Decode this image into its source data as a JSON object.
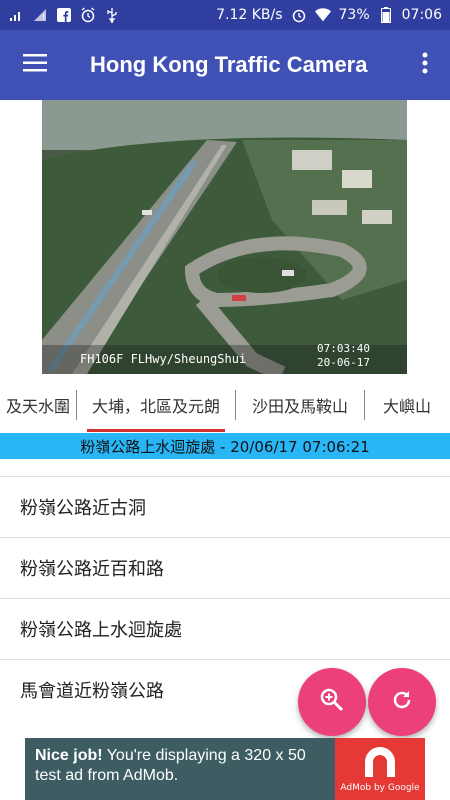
{
  "status_bar": {
    "net_speed": "7.12 KB/s",
    "battery": "73%",
    "time": "07:06"
  },
  "app_bar": {
    "title": "Hong Kong Traffic Camera"
  },
  "camera": {
    "overlay_code": "FH106F FLHwy/SheungShui",
    "overlay_time": "07:03:40",
    "overlay_date": "20-06-17"
  },
  "tabs": [
    {
      "label": "及天水圍"
    },
    {
      "label": "大埔，北區及元朗"
    },
    {
      "label": "沙田及馬鞍山"
    },
    {
      "label": "大嶼山"
    }
  ],
  "caption": "粉嶺公路上水迴旋處 - 20/06/17 07:06:21",
  "list": [
    {
      "label": "粉嶺公路近古洞"
    },
    {
      "label": "粉嶺公路近百和路"
    },
    {
      "label": "粉嶺公路上水迴旋處"
    },
    {
      "label": "馬會道近粉嶺公路"
    }
  ],
  "ad": {
    "bold": "Nice job!",
    "text": " You're displaying a 320 x 50 test ad from AdMob.",
    "logo_label": "AdMob by Google"
  },
  "colors": {
    "status_bar": "#303f9f",
    "app_bar": "#3f51b5",
    "accent": "#ec407a",
    "tab_indicator": "#d32f2f",
    "caption_bg": "#29b6f6"
  }
}
